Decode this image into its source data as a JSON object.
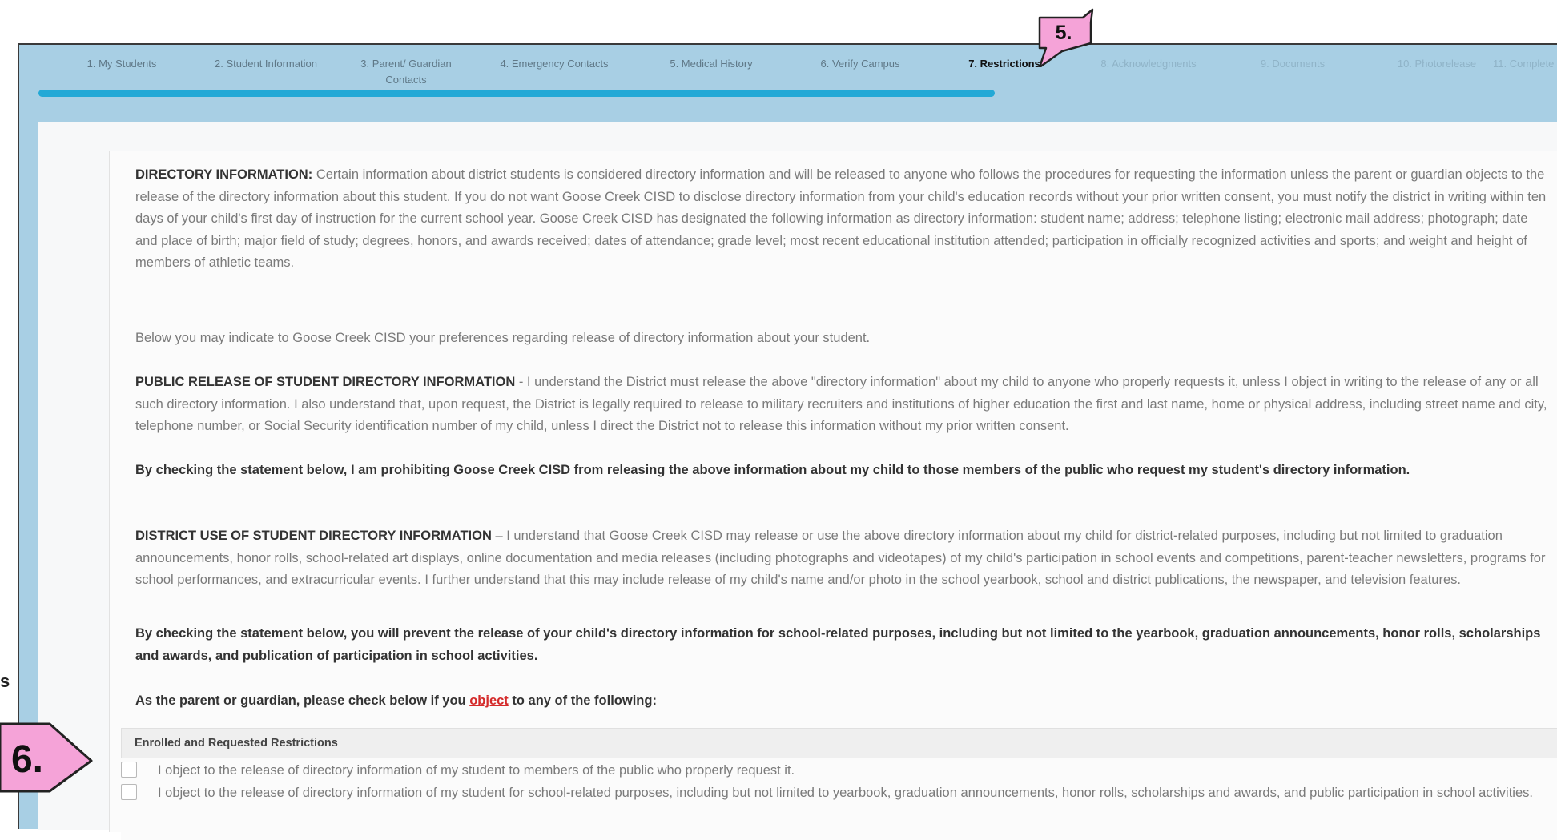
{
  "steps": [
    {
      "label": "1. My Students",
      "state": "done"
    },
    {
      "label": "2. Student Information",
      "state": "done"
    },
    {
      "label": "3. Parent/ Guardian Contacts",
      "state": "done"
    },
    {
      "label": "4. Emergency Contacts",
      "state": "done"
    },
    {
      "label": "5. Medical History",
      "state": "done"
    },
    {
      "label": "6. Verify Campus",
      "state": "done"
    },
    {
      "label": "7. Restrictions",
      "state": "active"
    },
    {
      "label": "8. Acknowledgments",
      "state": "upcoming"
    },
    {
      "label": "9. Documents",
      "state": "upcoming"
    },
    {
      "label": "10. Photorelease",
      "state": "upcoming"
    },
    {
      "label": "11. Complete",
      "state": "upcoming"
    }
  ],
  "progress_fraction": 0.63,
  "directory": {
    "heading": "DIRECTORY INFORMATION:",
    "body": "Certain information about district students is considered directory information and will be released to anyone who follows the procedures for requesting the information unless the parent or guardian objects to the release of the directory information about this student. If you do not want Goose Creek CISD to disclose directory information from your child's education records without your prior written consent, you must notify the district in writing within ten days of your child's first day of instruction for the current school year. Goose Creek CISD has designated the following information as directory information: student name; address; telephone listing; electronic mail address; photograph; date and place of birth; major field of study; degrees, honors, and awards received; dates of attendance; grade level; most recent educational institution attended; participation in officially recognized activities and sports; and weight and height of members of athletic teams."
  },
  "below_text": "Below you may indicate to Goose Creek CISD your preferences regarding release of directory information about your student.",
  "public_release": {
    "heading": "PUBLIC RELEASE OF STUDENT DIRECTORY INFORMATION",
    "body": " - I understand the District must release the above \"directory information\" about my child to anyone who properly requests it, unless I object in writing to the release of any or all such directory information. I also understand that, upon request, the District is legally required to release to military recruiters and institutions of higher education the first and last name, home or physical address, including street name and city, telephone number, or Social Security identification number of my child, unless I direct the District not to release this information without my prior written consent."
  },
  "prohibit_statement": "By checking the statement below, I am prohibiting Goose Creek CISD from releasing the above information about my child to those members of the public who request my student's directory information.",
  "district_use": {
    "heading": "DISTRICT USE OF STUDENT DIRECTORY INFORMATION",
    "body": " – I understand that Goose Creek CISD may release or use the above directory information about my child for district-related purposes, including but not limited to graduation announcements, honor rolls, school-related art displays, online documentation and media releases (including photographs and videotapes) of my child's participation in school events and competitions, parent-teacher newsletters, programs for school performances, and extracurricular events. I further understand that this may include release of my child's name and/or photo in the school yearbook, school and district publications, the newspaper, and television features."
  },
  "prevent_statement": "By checking the statement below, you will prevent the release of your child's directory information for school-related purposes, including but not limited to the yearbook, graduation announcements, honor rolls, scholarships and awards, and publication of participation in school activities.",
  "object_prompt": {
    "before": "As the parent or guardian, please check below if you ",
    "link": "object",
    "after": " to any of the following:"
  },
  "restrictions": {
    "header": "Enrolled and Requested Restrictions",
    "options": [
      {
        "text": "I object to the release of directory information of my student to members of the public who properly request it.",
        "checked": false
      },
      {
        "text": "I object to the release of directory information of my student for school-related purposes, including but not limited to yearbook, graduation announcements, honor rolls, scholarships and awards, and public participation in school activities.",
        "checked": false
      }
    ]
  },
  "callouts": {
    "five": "5.",
    "six": "6.",
    "side": "s"
  },
  "colors": {
    "callout_fill": "#f5a3d8",
    "progress": "#23a9d6",
    "frame": "#a8cfe4"
  }
}
